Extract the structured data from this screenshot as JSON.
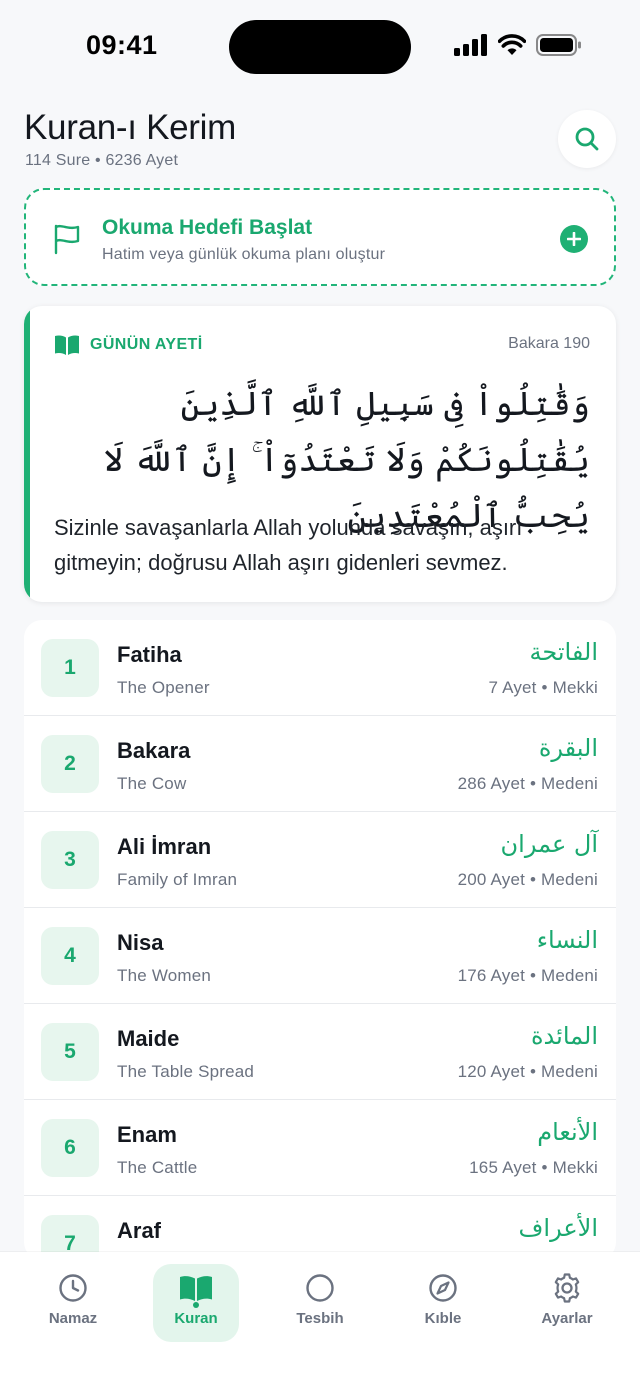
{
  "status_bar": {
    "time": "09:41"
  },
  "header": {
    "title": "Kuran-ı Kerim",
    "subtitle": "114 Sure • 6236 Ayet"
  },
  "goal": {
    "title": "Okuma Hedefi Başlat",
    "subtitle": "Hatim veya günlük okuma planı oluştur"
  },
  "verse_of_day": {
    "label": "GÜNÜN AYETİ",
    "reference": "Bakara 190",
    "arabic": "وَقَٰتِلُواْ فِى سَبِيلِ ٱللَّهِ ٱلَّذِينَ يُقَٰتِلُونَكُمْ وَلَا تَعْتَدُوٓاْ ۚ إِنَّ ٱللَّهَ لَا يُحِبُّ ٱلْمُعْتَدِينَ",
    "translation": "Sizinle savaşanlarla Allah yolunda savaşın, aşırı gitmeyin; doğrusu Allah aşırı gidenleri sevmez."
  },
  "suras": [
    {
      "number": "1",
      "name": "Fatiha",
      "english": "The Opener",
      "arabic": "الفاتحة",
      "meta": "7 Ayet • Mekki"
    },
    {
      "number": "2",
      "name": "Bakara",
      "english": "The Cow",
      "arabic": "البقرة",
      "meta": "286 Ayet • Medeni"
    },
    {
      "number": "3",
      "name": "Ali İmran",
      "english": "Family of Imran",
      "arabic": "آل عمران",
      "meta": "200 Ayet • Medeni"
    },
    {
      "number": "4",
      "name": "Nisa",
      "english": "The Women",
      "arabic": "النساء",
      "meta": "176 Ayet • Medeni"
    },
    {
      "number": "5",
      "name": "Maide",
      "english": "The Table Spread",
      "arabic": "المائدة",
      "meta": "120 Ayet • Medeni"
    },
    {
      "number": "6",
      "name": "Enam",
      "english": "The Cattle",
      "arabic": "الأنعام",
      "meta": "165 Ayet • Mekki"
    },
    {
      "number": "7",
      "name": "Araf",
      "english": "",
      "arabic": "الأعراف",
      "meta": ""
    }
  ],
  "tabs": [
    {
      "label": "Namaz",
      "icon": "clock-icon"
    },
    {
      "label": "Kuran",
      "icon": "book-icon",
      "active": true
    },
    {
      "label": "Tesbih",
      "icon": "circle-icon"
    },
    {
      "label": "Kıble",
      "icon": "compass-icon"
    },
    {
      "label": "Ayarlar",
      "icon": "gear-icon"
    }
  ],
  "colors": {
    "accent": "#1fb074",
    "accent_soft": "#e7f6ee",
    "muted": "#6b7280"
  }
}
